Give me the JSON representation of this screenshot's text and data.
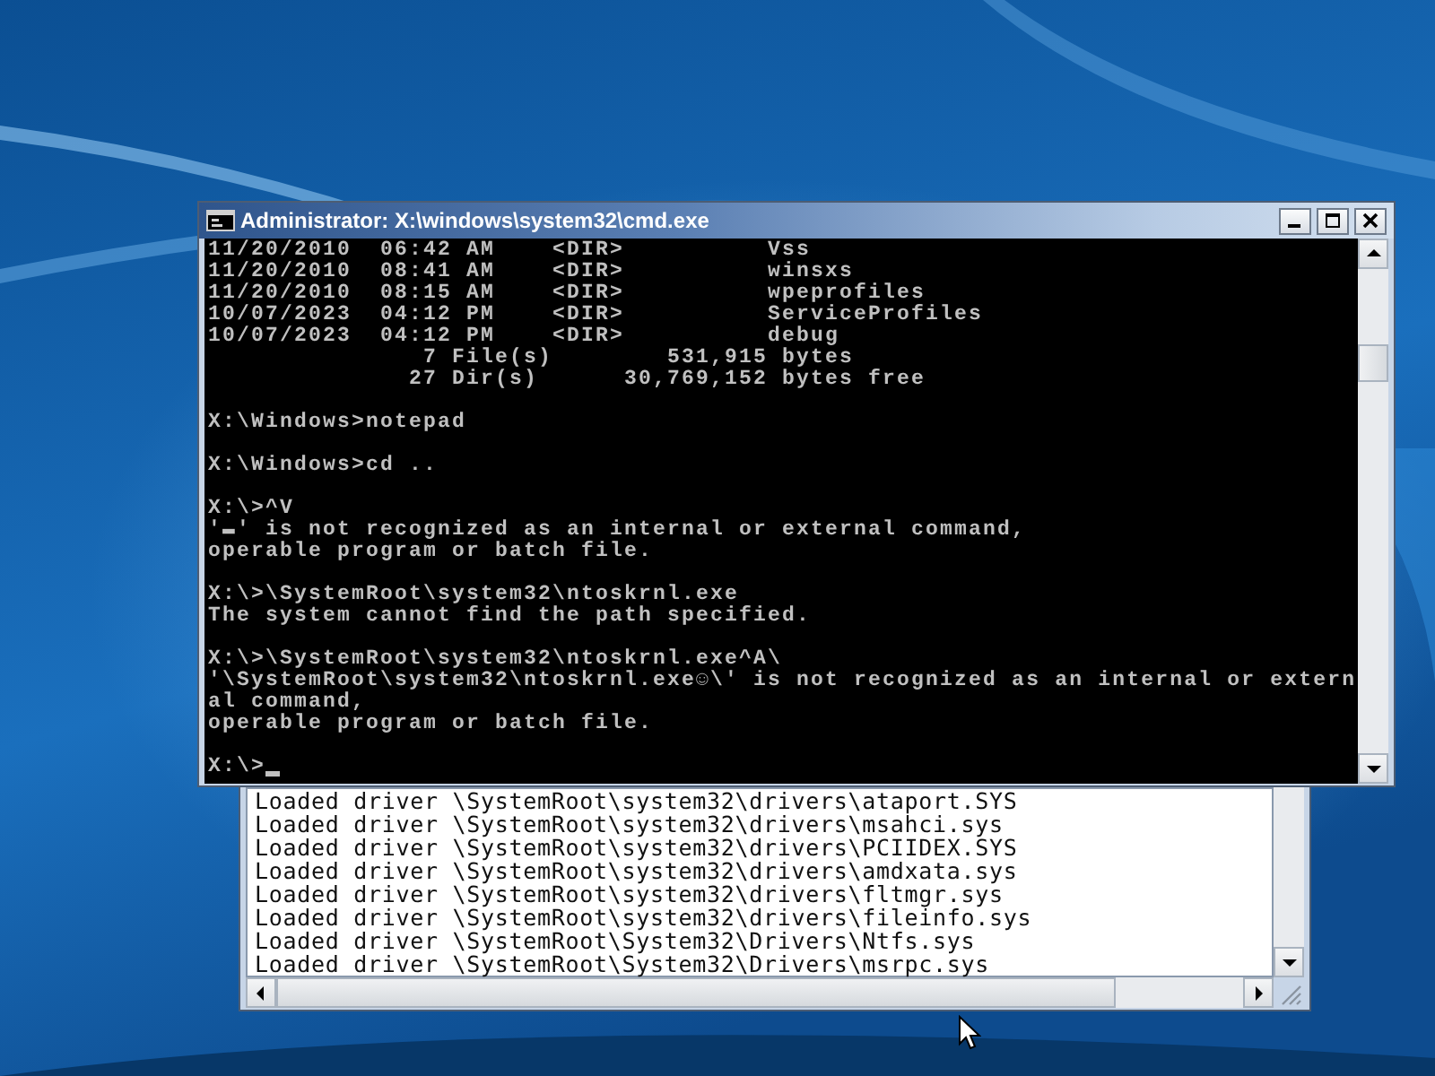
{
  "notepad_window": {
    "lines": [
      "Loaded driver \\SystemRoot\\system32\\drivers\\ataport.SYS",
      "Loaded driver \\SystemRoot\\system32\\drivers\\msahci.sys",
      "Loaded driver \\SystemRoot\\system32\\drivers\\PCIIDEX.SYS",
      "Loaded driver \\SystemRoot\\system32\\drivers\\amdxata.sys",
      "Loaded driver \\SystemRoot\\system32\\drivers\\fltmgr.sys",
      "Loaded driver \\SystemRoot\\system32\\drivers\\fileinfo.sys",
      "Loaded driver \\SystemRoot\\System32\\Drivers\\Ntfs.sys",
      "Loaded driver \\SystemRoot\\System32\\Drivers\\msrpc.sys"
    ]
  },
  "console_window": {
    "title": "Administrator: X:\\windows\\system32\\cmd.exe",
    "blocks": [
      [
        "11/20/2010  06:42 AM    <DIR>          Vss",
        "11/20/2010  08:41 AM    <DIR>          winsxs",
        "11/20/2010  08:15 AM    <DIR>          wpeprofiles",
        "10/07/2023  04:12 PM    <DIR>          ServiceProfiles",
        "10/07/2023  04:12 PM    <DIR>          debug",
        "               7 File(s)        531,915 bytes",
        "              27 Dir(s)      30,769,152 bytes free"
      ],
      [
        "X:\\Windows>notepad"
      ],
      [
        "X:\\Windows>cd .."
      ],
      [
        "X:\\>^V",
        "'▬' is not recognized as an internal or external command,",
        "operable program or batch file."
      ],
      [
        "X:\\>\\SystemRoot\\system32\\ntoskrnl.exe",
        "The system cannot find the path specified."
      ],
      [
        "X:\\>\\SystemRoot\\system32\\ntoskrnl.exe^A\\",
        "'\\SystemRoot\\system32\\ntoskrnl.exe☺\\' is not recognized as an internal or extern",
        "al command,",
        "operable program or batch file."
      ]
    ],
    "prompt": "X:\\>"
  }
}
